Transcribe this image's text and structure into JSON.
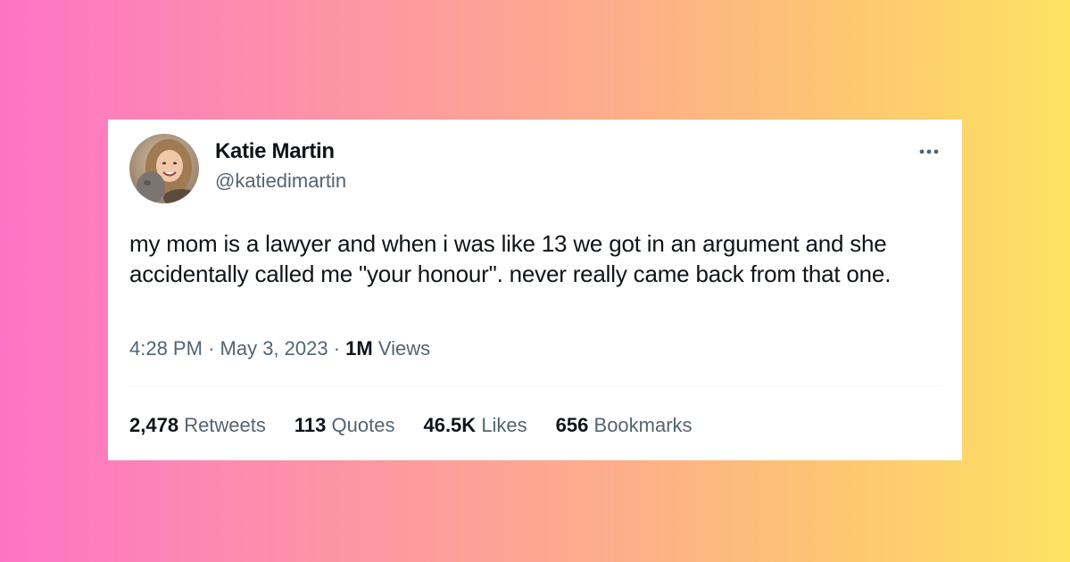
{
  "tweet": {
    "author": {
      "name": "Katie Martin",
      "handle": "@katiedimartin",
      "avatar_icon": "profile-photo"
    },
    "more_icon": "ellipsis-icon",
    "text": "my mom is a lawyer and when i was like 13 we got in an argument and she accidentally called me \"your honour\". never really came back from that one.",
    "time": "4:28 PM",
    "date": "May 3, 2023",
    "views_count": "1M",
    "views_label": "Views",
    "separator": "·",
    "stats": [
      {
        "count": "2,478",
        "label": "Retweets"
      },
      {
        "count": "113",
        "label": "Quotes"
      },
      {
        "count": "46.5K",
        "label": "Likes"
      },
      {
        "count": "656",
        "label": "Bookmarks"
      }
    ]
  },
  "colors": {
    "background_gradient_start": "#fd74c6",
    "background_gradient_end": "#fde264",
    "card": "#ffffff",
    "primary_text": "#0f1419",
    "secondary_text": "#536471"
  }
}
